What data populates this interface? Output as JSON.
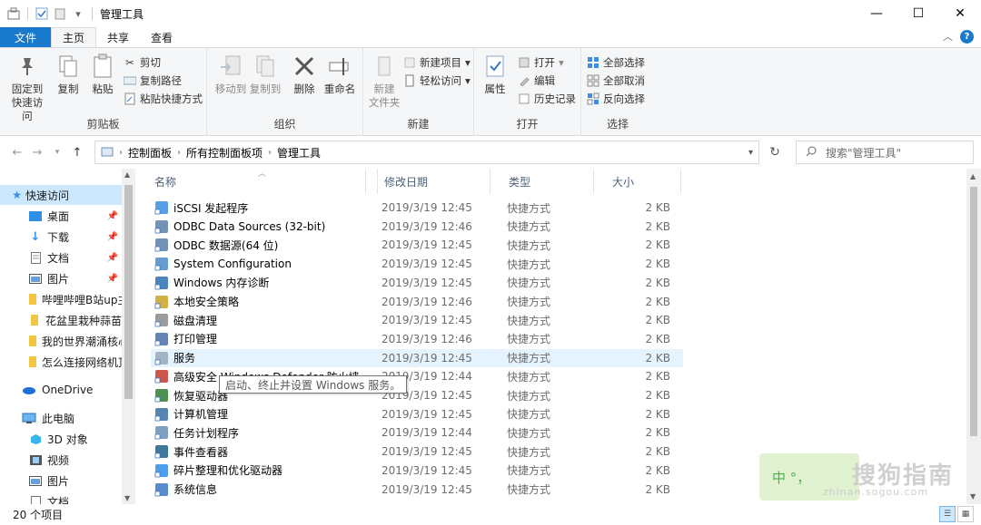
{
  "window": {
    "title": "管理工具"
  },
  "ribbon_tabs": [
    "文件",
    "主页",
    "共享",
    "查看"
  ],
  "ribbon": {
    "clipboard": {
      "pin": "固定到\n快速访问",
      "copy": "复制",
      "paste": "粘贴",
      "cut": "剪切",
      "copy_path": "复制路径",
      "paste_shortcut": "粘贴快捷方式",
      "label": "剪贴板"
    },
    "organize": {
      "move_to": "移动到",
      "copy_to": "复制到",
      "delete": "删除",
      "rename": "重命名",
      "label": "组织"
    },
    "new": {
      "new_folder": "新建\n文件夹",
      "new_item": "新建项目",
      "easy_access": "轻松访问",
      "label": "新建"
    },
    "open": {
      "properties": "属性",
      "open": "打开",
      "edit": "编辑",
      "history": "历史记录",
      "label": "打开"
    },
    "select": {
      "select_all": "全部选择",
      "select_none": "全部取消",
      "invert": "反向选择",
      "label": "选择"
    }
  },
  "address": {
    "crumbs": [
      "控制面板",
      "所有控制面板项",
      "管理工具"
    ]
  },
  "search": {
    "placeholder": "搜索\"管理工具\""
  },
  "sidebar": {
    "quick_access": "快速访问",
    "items": [
      {
        "label": "桌面",
        "pinned": true
      },
      {
        "label": "下载",
        "pinned": true
      },
      {
        "label": "文档",
        "pinned": true
      },
      {
        "label": "图片",
        "pinned": true
      },
      {
        "label": "哔哩哔哩B站up主"
      },
      {
        "label": "花盆里栽种蒜苗"
      },
      {
        "label": "我的世界潮涌核心"
      },
      {
        "label": "怎么连接网络机顶"
      }
    ],
    "onedrive": "OneDrive",
    "this_pc": "此电脑",
    "pc_items": [
      "3D 对象",
      "视频",
      "图片",
      "文档"
    ]
  },
  "columns": {
    "name": "名称",
    "date": "修改日期",
    "type": "类型",
    "size": "大小"
  },
  "files": [
    {
      "name": "iSCSI 发起程序",
      "date": "2019/3/19 12:45",
      "type": "快捷方式",
      "size": "2 KB"
    },
    {
      "name": "ODBC Data Sources (32-bit)",
      "date": "2019/3/19 12:46",
      "type": "快捷方式",
      "size": "2 KB"
    },
    {
      "name": "ODBC 数据源(64 位)",
      "date": "2019/3/19 12:45",
      "type": "快捷方式",
      "size": "2 KB"
    },
    {
      "name": "System Configuration",
      "date": "2019/3/19 12:45",
      "type": "快捷方式",
      "size": "2 KB"
    },
    {
      "name": "Windows 内存诊断",
      "date": "2019/3/19 12:45",
      "type": "快捷方式",
      "size": "2 KB"
    },
    {
      "name": "本地安全策略",
      "date": "2019/3/19 12:46",
      "type": "快捷方式",
      "size": "2 KB"
    },
    {
      "name": "磁盘清理",
      "date": "2019/3/19 12:45",
      "type": "快捷方式",
      "size": "2 KB"
    },
    {
      "name": "打印管理",
      "date": "2019/3/19 12:46",
      "type": "快捷方式",
      "size": "2 KB"
    },
    {
      "name": "服务",
      "date": "2019/3/19 12:45",
      "type": "快捷方式",
      "size": "2 KB"
    },
    {
      "name": "高级安全 Windows Defender 防火墙",
      "date": "2019/3/19 12:44",
      "type": "快捷方式",
      "size": "2 KB"
    },
    {
      "name": "恢复驱动器",
      "date": "2019/3/19 12:45",
      "type": "快捷方式",
      "size": "2 KB"
    },
    {
      "name": "计算机管理",
      "date": "2019/3/19 12:45",
      "type": "快捷方式",
      "size": "2 KB"
    },
    {
      "name": "任务计划程序",
      "date": "2019/3/19 12:44",
      "type": "快捷方式",
      "size": "2 KB"
    },
    {
      "name": "事件查看器",
      "date": "2019/3/19 12:45",
      "type": "快捷方式",
      "size": "2 KB"
    },
    {
      "name": "碎片整理和优化驱动器",
      "date": "2019/3/19 12:45",
      "type": "快捷方式",
      "size": "2 KB"
    },
    {
      "name": "系统信息",
      "date": "2019/3/19 12:45",
      "type": "快捷方式",
      "size": "2 KB"
    }
  ],
  "tooltip": "启动、终止并设置 Windows 服务。",
  "status": {
    "count": "20 个项目"
  },
  "watermark": {
    "left": "中 °，",
    "right": "搜狗指南",
    "sub": "zhinan.sogou.com"
  },
  "colors": {
    "accent": "#1979ca",
    "selected_bg": "#cce8ff",
    "hover_bg": "#e5f3ff"
  }
}
